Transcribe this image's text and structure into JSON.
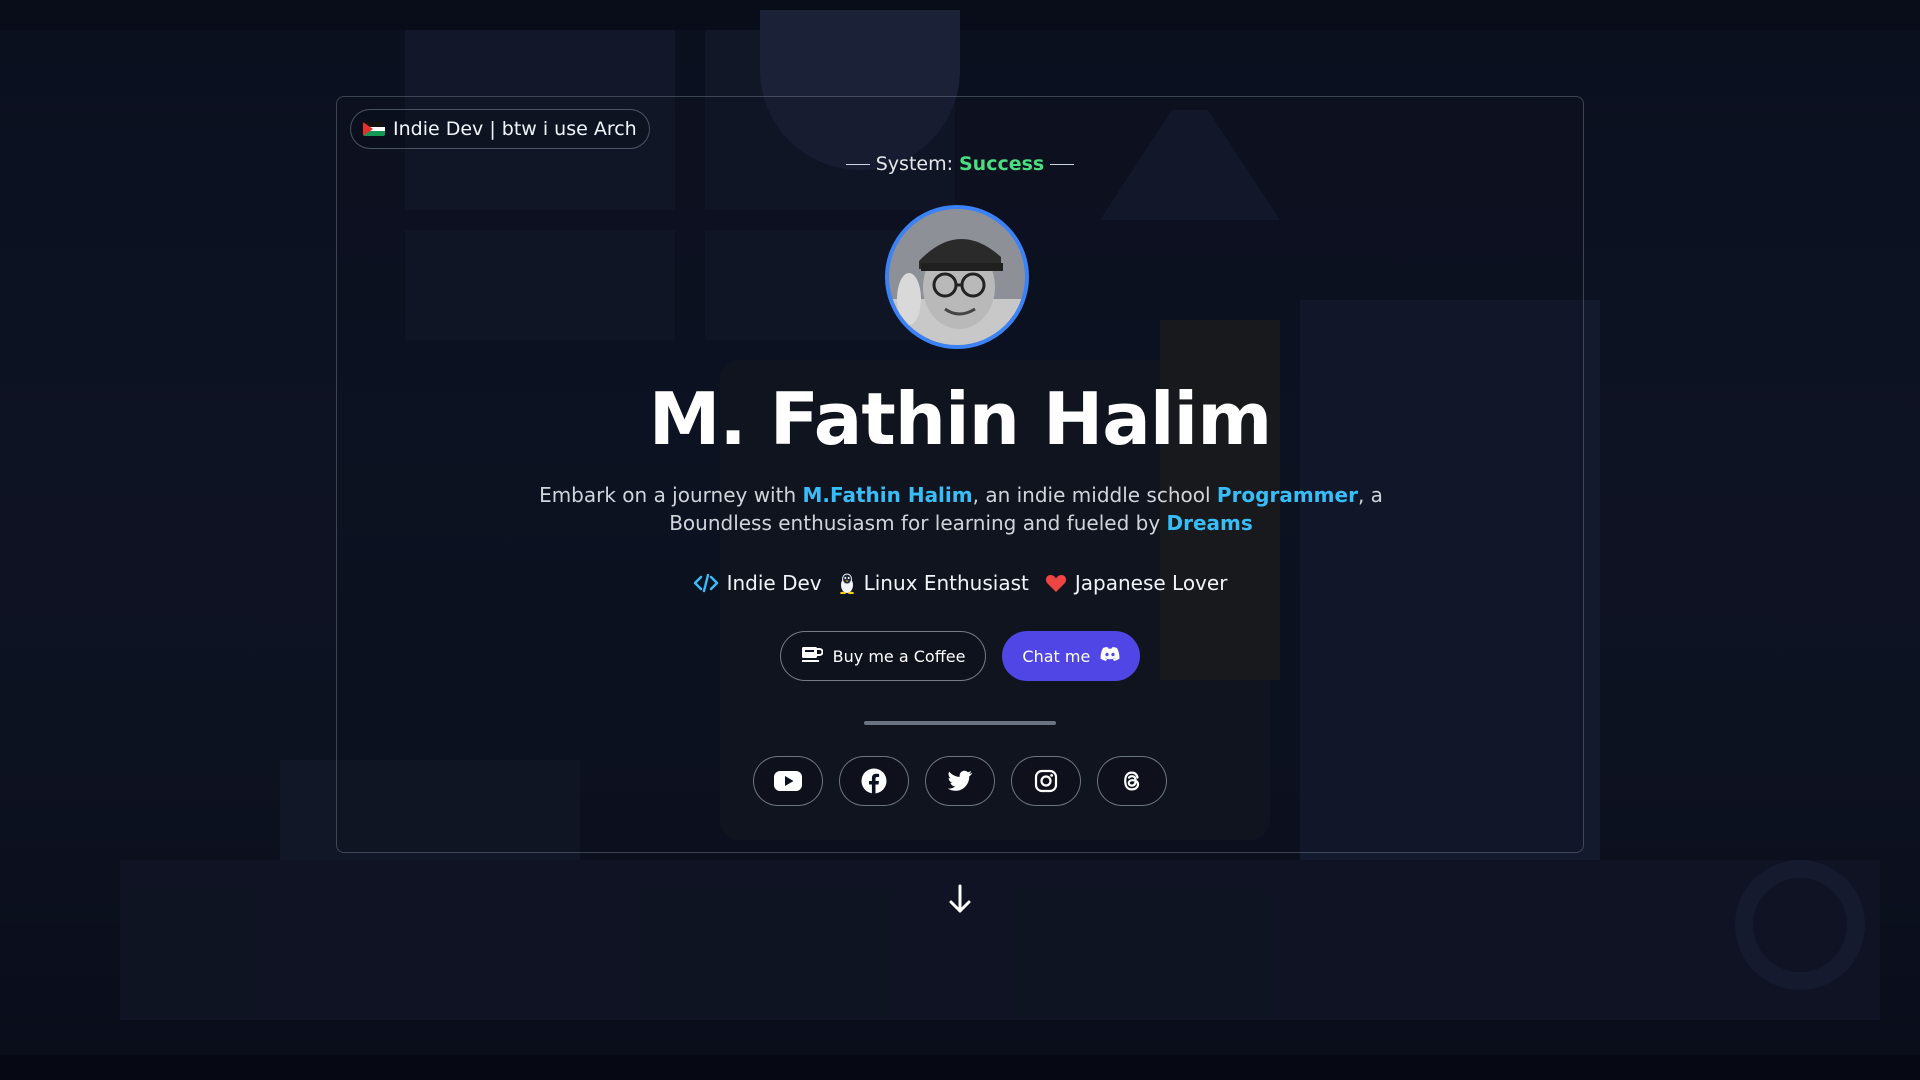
{
  "badge": {
    "label": "Indie Dev | btw i use Arch"
  },
  "status": {
    "prefix": "System:",
    "value": "Success"
  },
  "profile": {
    "name": "M. Fathin Halim",
    "intro": {
      "p1": "Embark on a journey with ",
      "h1": "M.Fathin Halim",
      "p2": ", an indie middle school ",
      "h2": "Programmer",
      "p3": ", a Boundless enthusiasm for learning and fueled by ",
      "h3": "Dreams"
    }
  },
  "tags": [
    {
      "label": "Indie Dev",
      "icon": "code-icon"
    },
    {
      "label": "Linux Enthusiast",
      "icon": "linux-penguin-icon"
    },
    {
      "label": "Japanese Lover",
      "icon": "heart-icon"
    }
  ],
  "actions": {
    "coffee_label": "Buy me a Coffee",
    "chat_label": "Chat me"
  },
  "socials": [
    "youtube-icon",
    "facebook-icon",
    "twitter-icon",
    "instagram-icon",
    "threads-icon"
  ],
  "colors": {
    "accent": "#38bdf8",
    "success": "#4ade80",
    "primary_button": "#4f46e5",
    "avatar_ring": "#3b82f6",
    "heart": "#ef4444"
  }
}
